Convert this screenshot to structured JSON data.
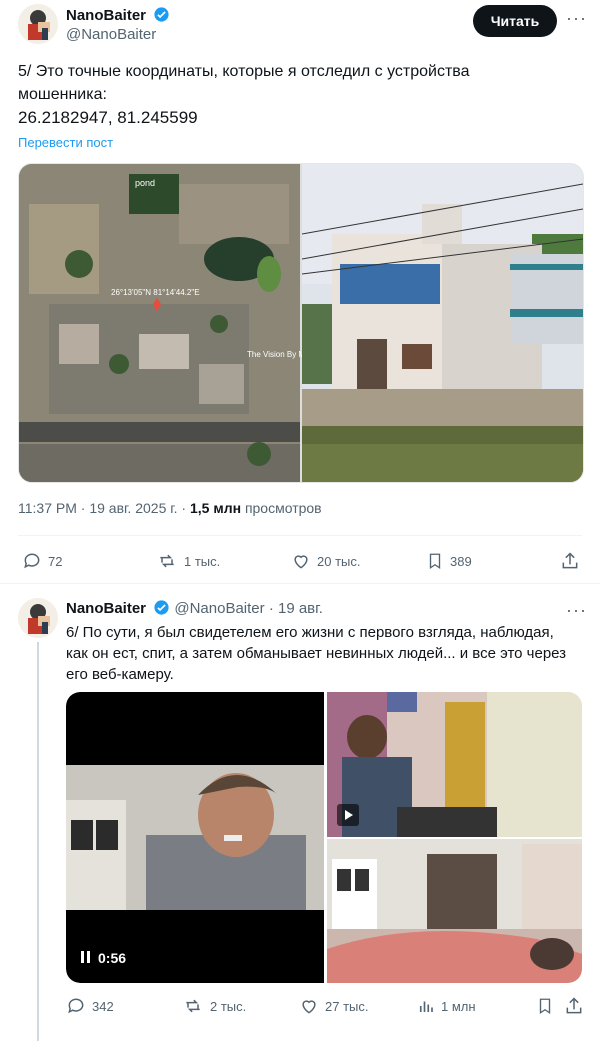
{
  "tweet1": {
    "author_name": "NanoBaiter",
    "handle": "@NanoBaiter",
    "follow_label": "Читать",
    "text_line1": "5/ Это точные координаты, которые я отследил с устройства",
    "text_line2": "мошенника:",
    "coords": "26.2182947, 81.245599",
    "translate_label": "Перевести пост",
    "map_labels": {
      "pond": "pond",
      "coords_overlay": "26°13'05\"N 81°14'44.2\"E",
      "vision": "The Vision By M"
    },
    "time": "11:37 PM",
    "date": "19 авг. 2025 г.",
    "views_count": "1,5 млн",
    "views_label": "просмотров",
    "stats": {
      "replies": "72",
      "retweets": "1 тыс.",
      "likes": "20 тыс.",
      "bookmarks": "389"
    }
  },
  "tweet2": {
    "author_name": "NanoBaiter",
    "handle": "@NanoBaiter",
    "date": "· 19 авг.",
    "text_line1": "6/ По сути, я был свидетелем его жизни с первого взгляда, наблюдая,",
    "text_line2": "как он ест, спит, а затем обманывает невинных людей... и все это через",
    "text_line3": "его веб-камеру.",
    "video_time": "0:56",
    "stats": {
      "replies": "342",
      "retweets": "2 тыс.",
      "likes": "27 тыс.",
      "views": "1 млн"
    }
  },
  "colors": {
    "accent": "#1d9bf0",
    "text": "#0f1419",
    "muted": "#536471"
  },
  "icons": [
    "verified-badge-icon",
    "more-icon",
    "reply-icon",
    "retweet-icon",
    "like-icon",
    "bookmark-icon",
    "share-icon",
    "views-icon",
    "play-icon",
    "pause-icon"
  ]
}
